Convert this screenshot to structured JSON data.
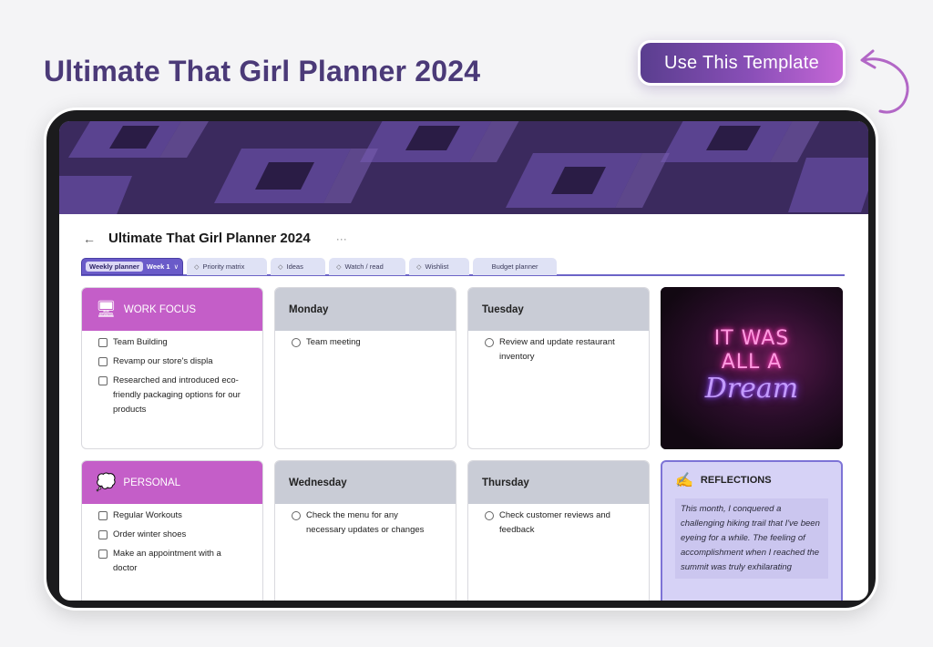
{
  "headline": "Ultimate That Girl Planner 2024",
  "cta_label": "Use This Template",
  "page": {
    "back_icon": "←",
    "title": "Ultimate That Girl Planner 2024",
    "more_icon": "···"
  },
  "tabs": {
    "active": {
      "label": "Weekly planner",
      "view": "Week 1",
      "chevron": "∨"
    },
    "others": [
      {
        "icon": "◇",
        "label": "Priority matrix"
      },
      {
        "icon": "◇",
        "label": "Ideas"
      },
      {
        "icon": "◇",
        "label": "Watch / read"
      },
      {
        "icon": "◇",
        "label": "Wishlist"
      },
      {
        "icon": "",
        "label": "Budget planner"
      }
    ]
  },
  "work_focus": {
    "icon": "🖥",
    "title": "WORK FOCUS",
    "items": [
      "Team Building",
      "Revamp our store's displa",
      "Researched and introduced eco-friendly packaging options for our products"
    ]
  },
  "personal": {
    "icon": "💭",
    "title": "PERSONAL",
    "items": [
      "Regular Workouts",
      "Order winter shoes",
      "Make an appointment with a doctor"
    ]
  },
  "days": {
    "monday": {
      "title": "Monday",
      "items": [
        "Team meeting"
      ]
    },
    "tuesday": {
      "title": "Tuesday",
      "items": [
        "Review and update restaurant inventory"
      ]
    },
    "wednesday": {
      "title": "Wednesday",
      "items": [
        "Check the menu for any necessary updates or changes"
      ]
    },
    "thursday": {
      "title": "Thursday",
      "items": [
        "Check customer reviews and feedback"
      ]
    }
  },
  "neon_sign": {
    "line1": "IT WAS",
    "line2": "ALL A",
    "line3": "Dream"
  },
  "reflections": {
    "icon": "✍️",
    "title": "REFLECTIONS",
    "text": "This month, I conquered a challenging hiking trail that I've been eyeing for a while. The feeling of accomplishment when I reached the summit was truly exhilarating"
  }
}
